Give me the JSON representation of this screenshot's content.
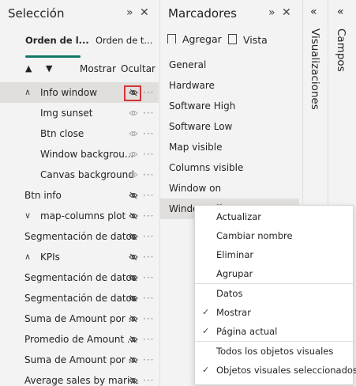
{
  "selection": {
    "title": "Selección",
    "tabs": [
      "Orden de l...",
      "Orden de t..."
    ],
    "show_label": "Mostrar",
    "hide_label": "Ocultar",
    "rows": [
      {
        "label": "Info window",
        "level": 0,
        "expand": "open",
        "selected": true
      },
      {
        "label": "Img sunset",
        "level": 1
      },
      {
        "label": "Btn close",
        "level": 1
      },
      {
        "label": "Window backgrou...",
        "level": 1
      },
      {
        "label": "Canvas background",
        "level": 1
      },
      {
        "label": "Btn info",
        "level": 0
      },
      {
        "label": "map-columns plot",
        "level": 0,
        "expand": "closed"
      },
      {
        "label": "Segmentación de datos",
        "level": 0
      },
      {
        "label": "KPIs",
        "level": 0,
        "expand": "open"
      },
      {
        "label": "Segmentación de datos",
        "level": 0
      },
      {
        "label": "Segmentación de datos",
        "level": 0
      },
      {
        "label": "Suma de Amount por ...",
        "level": 0
      },
      {
        "label": "Promedio de Amount ...",
        "level": 0
      },
      {
        "label": "Suma de Amount por ...",
        "level": 0
      },
      {
        "label": "Average sales by mari...",
        "level": 0
      }
    ]
  },
  "bookmarks": {
    "title": "Marcadores",
    "add_label": "Agregar",
    "view_label": "Vista",
    "items": [
      "General",
      "Hardware",
      "Software High",
      "Software Low",
      "Map visible",
      "Columns visible",
      "Window on",
      "Window off"
    ]
  },
  "visualizations": {
    "title": "Visualizaciones"
  },
  "fields": {
    "title": "Campos"
  },
  "context_menu": {
    "items": [
      {
        "label": "Actualizar",
        "checked": false
      },
      {
        "label": "Cambiar nombre",
        "checked": false
      },
      {
        "label": "Eliminar",
        "checked": false
      },
      {
        "label": "Agrupar",
        "checked": false
      },
      {
        "label": "Datos",
        "checked": false
      },
      {
        "label": "Mostrar",
        "checked": true
      },
      {
        "label": "Página actual",
        "checked": true
      },
      {
        "label": "Todos los objetos visuales",
        "checked": false
      },
      {
        "label": "Objetos visuales seleccionados",
        "checked": true
      }
    ]
  },
  "colors": {
    "accent": "#117865",
    "highlight_box": "#d13438"
  }
}
